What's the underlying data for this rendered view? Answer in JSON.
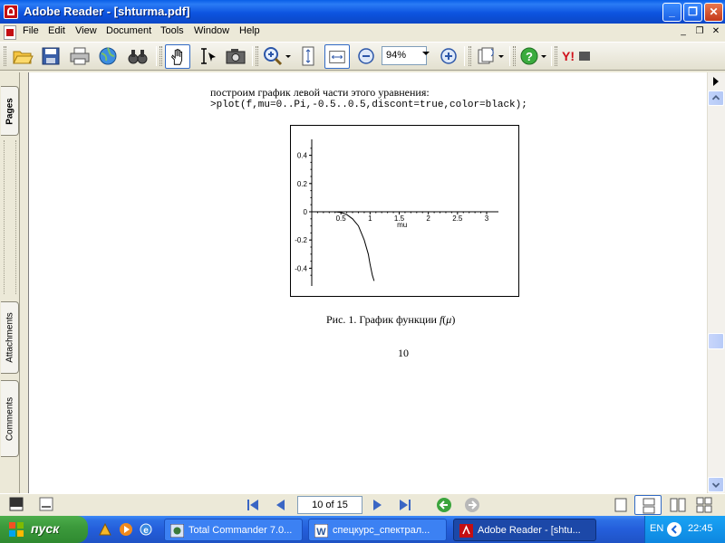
{
  "window": {
    "title": "Adobe Reader - [shturma.pdf]"
  },
  "menu": {
    "items": [
      "File",
      "Edit",
      "View",
      "Document",
      "Tools",
      "Window",
      "Help"
    ]
  },
  "toolbar": {
    "zoom": "94%"
  },
  "sidebar": {
    "tabs": [
      "Pages",
      "Attachments",
      "Comments"
    ]
  },
  "document": {
    "line1": "построим график левой части этого уравнения:",
    "line2": ">plot(f,mu=0..Pi,-0.5..0.5,discont=true,color=black);",
    "caption_prefix": "Рис. 1. График функции",
    "caption_func": "f",
    "caption_var": "μ",
    "page_number": "10"
  },
  "chart_data": {
    "type": "line",
    "xlabel": "mu",
    "xlim": [
      0,
      3.14
    ],
    "ylim": [
      -0.5,
      0.5
    ],
    "x_ticks": [
      "0.5",
      "1",
      "1.5",
      "2",
      "2.5",
      "3"
    ],
    "y_ticks": [
      "0.4",
      "0.2",
      "0",
      "-0.2",
      "-0.4"
    ],
    "series": [
      {
        "color": "#000000",
        "points": [
          [
            0.28,
            0.0
          ],
          [
            0.4,
            0.0
          ],
          [
            0.5,
            -0.005
          ],
          [
            0.6,
            -0.02
          ],
          [
            0.7,
            -0.05
          ],
          [
            0.8,
            -0.1
          ],
          [
            0.9,
            -0.2
          ],
          [
            0.97,
            -0.3
          ],
          [
            1.0,
            -0.37
          ],
          [
            1.04,
            -0.45
          ],
          [
            1.07,
            -0.49
          ]
        ]
      }
    ]
  },
  "statusbar": {
    "page_display": "10 of 15"
  },
  "taskbar": {
    "start_label": "пуск",
    "tasks": [
      "Total Commander 7.0...",
      "спецкурс_спектрал...",
      "Adobe Reader - [shtu..."
    ],
    "lang": "EN",
    "clock": "22:45"
  }
}
